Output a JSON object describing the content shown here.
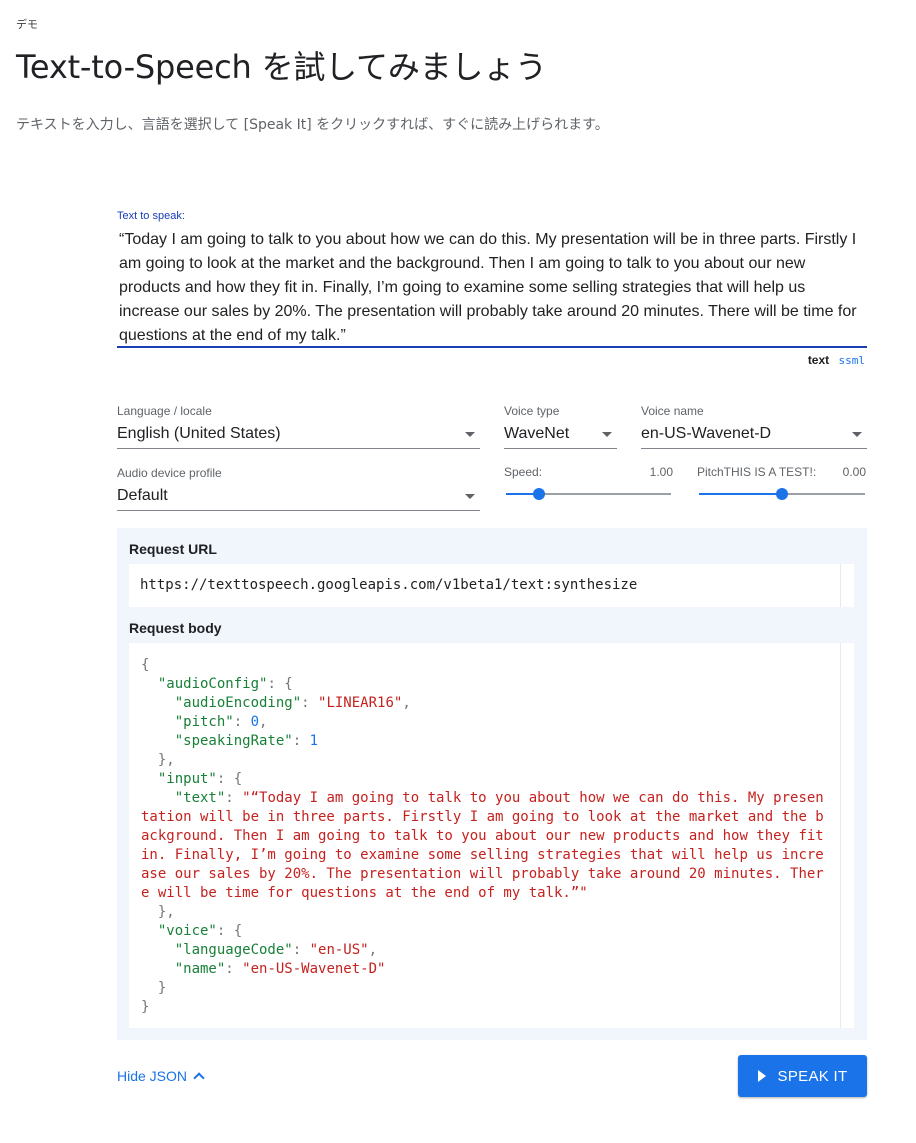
{
  "header": {
    "eyebrow": "デモ",
    "title": "Text-to-Speech を試してみましょう",
    "subtitle": "テキストを入力し、言語を選択して [Speak It] をクリックすれば、すぐに読み上げられます。"
  },
  "text_input": {
    "label": "Text to speak:",
    "value": "“Today I am going to talk to you about how we can do this. My presentation will be in three parts. Firstly I am going to look at the market and the background. Then I am going to talk to you about our new products and how they fit in. Finally, I’m going to examine some selling strategies that will help us increase our sales by 20%. The presentation will probably take around 20 minutes. There will be time for questions at the end of my talk.”",
    "mode_text": "text",
    "mode_ssml": "ssml"
  },
  "controls": {
    "language": {
      "label": "Language / locale",
      "value": "English (United States)"
    },
    "voice_type": {
      "label": "Voice type",
      "value": "WaveNet"
    },
    "voice_name": {
      "label": "Voice name",
      "value": "en-US-Wavenet-D"
    },
    "audio_profile": {
      "label": "Audio device profile",
      "value": "Default"
    },
    "speed": {
      "label": "Speed:",
      "value_text": "1.00",
      "level": 0.2
    },
    "pitch": {
      "label": "PitchTHIS IS A TEST!:",
      "value_text": "0.00",
      "level": 0.5
    }
  },
  "json_panel": {
    "url_heading": "Request URL",
    "url": "https://texttospeech.googleapis.com/v1beta1/text:synthesize",
    "body_heading": "Request body",
    "body": {
      "audioEncoding": "\"LINEAR16\"",
      "pitch": "0",
      "speakingRate": "1",
      "text_lines": [
        "\"“Today I am going to talk to you about how we can do this. My presen",
        "tation will be in three parts. Firstly I am going to look at the market and the b",
        "ackground. Then I am going to talk to you about our new products and how they fit",
        "in. Finally, I’m going to examine some selling strategies that will help us incre",
        "ase our sales by 20%. The presentation will probably take around 20 minutes. Ther",
        "e will be time for questions at the end of my talk.”\""
      ],
      "languageCode": "\"en-US\"",
      "name": "\"en-US-Wavenet-D\""
    }
  },
  "footer": {
    "hide_json": "Hide JSON",
    "speak_button": "SPEAK IT"
  },
  "colors": {
    "accent": "#1a73e8",
    "text_underline": "#1a3fb4",
    "panel_bg": "#f1f6fd",
    "json_key": "#188038",
    "json_string": "#c5221f"
  },
  "icons": {
    "dropdown": "caret-down-icon",
    "hide_json": "chevron-up-icon",
    "speak": "play-icon"
  }
}
